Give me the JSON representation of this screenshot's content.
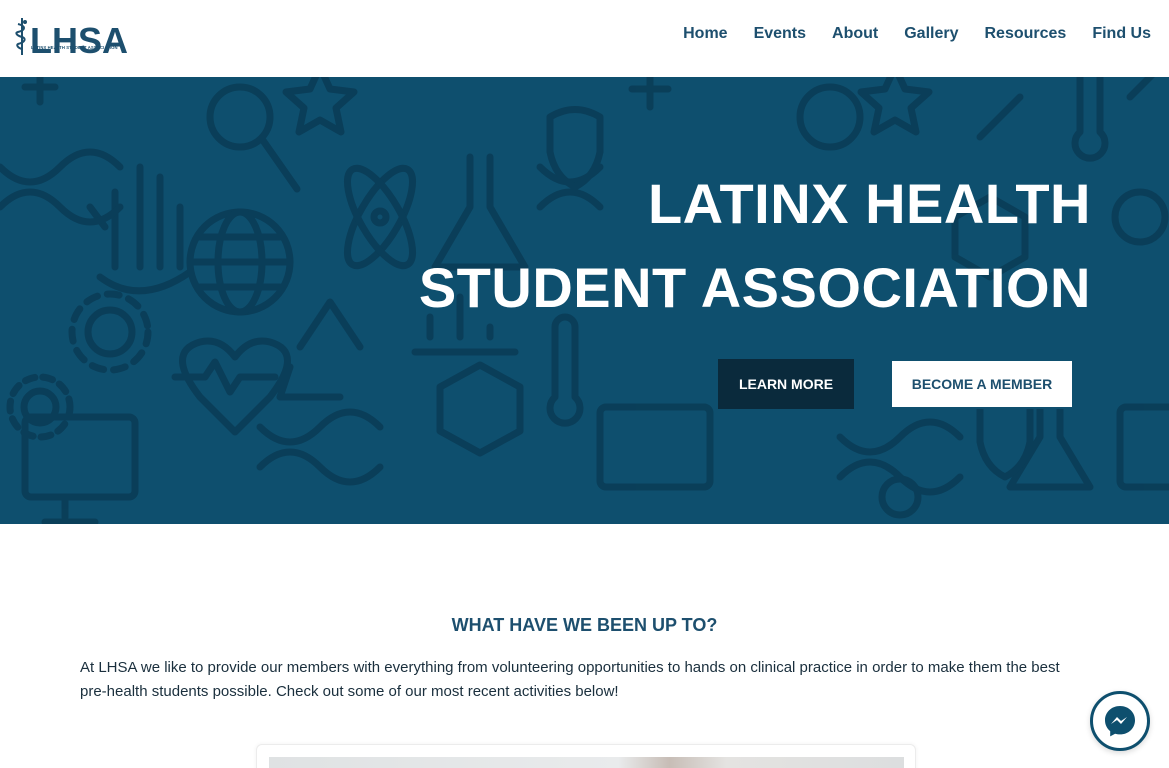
{
  "brand": {
    "logo_text": "LHSA",
    "logo_subtitle": "LATINX HEALTH STUDENT ASSOCIATION",
    "logo_icon": "caduceus-icon"
  },
  "nav": {
    "items": [
      {
        "label": "Home"
      },
      {
        "label": "Events"
      },
      {
        "label": "About"
      },
      {
        "label": "Gallery"
      },
      {
        "label": "Resources"
      },
      {
        "label": "Find Us"
      }
    ]
  },
  "hero": {
    "title_line1": "LATINX HEALTH",
    "title_line2": "STUDENT ASSOCIATION",
    "learn_more_label": "LEARN MORE",
    "become_member_label": "BECOME A MEMBER",
    "background_color": "#0e4f6e"
  },
  "activities": {
    "title": "WHAT HAVE WE BEEN UP TO?",
    "description": "At LHSA we like to provide our members with everything from volunteering opportunities to hands on clinical practice in order to make them the best pre-health students possible. Check out some of our most recent activities below!"
  },
  "messenger": {
    "icon": "messenger-icon"
  },
  "colors": {
    "brand": "#1d4f6e",
    "hero": "#0e4f6e",
    "dark_button": "#0a2a3c"
  }
}
